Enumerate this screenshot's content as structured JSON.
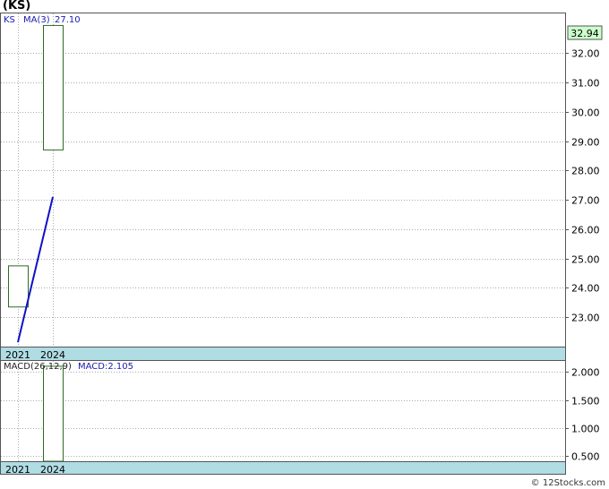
{
  "title": "(KS)",
  "credit": "© 12Stocks.com",
  "colors": {
    "candle_stroke": "#2e6b22",
    "ma_line": "#1010c8",
    "label_blue": "#1a1ab4",
    "axis_band": "#b0dce4",
    "last_price_bg": "#ccffcc",
    "grid": "#aaaaaa"
  },
  "chart_data": [
    {
      "type": "candlestick",
      "legend": {
        "symbol": "KS",
        "ma_label": "MA(3)",
        "ma_value": "27.10"
      },
      "categories": [
        "2021",
        "2024"
      ],
      "candles": [
        {
          "x": "2021",
          "open": 23.35,
          "close": 24.75,
          "high": 24.75,
          "low": 23.35
        },
        {
          "x": "2024",
          "open": 28.7,
          "close": 32.94,
          "high": 32.94,
          "low": 28.7
        }
      ],
      "ma_line": [
        {
          "x": "2021",
          "y": 22.15
        },
        {
          "x": "2024",
          "y": 27.1
        }
      ],
      "last_price": "32.94",
      "yticks": [
        "23.00",
        "24.00",
        "25.00",
        "26.00",
        "27.00",
        "28.00",
        "29.00",
        "30.00",
        "31.00",
        "32.00"
      ],
      "ytick_values": [
        23,
        24,
        25,
        26,
        27,
        28,
        29,
        30,
        31,
        32
      ],
      "ylim": [
        22,
        33.35
      ],
      "xlabels": [
        "2021",
        "2024"
      ],
      "grid": true
    },
    {
      "type": "bar",
      "legend": {
        "label": "MACD(26,12,9)",
        "value_label": "MACD:2.105"
      },
      "categories": [
        "2021",
        "2024"
      ],
      "values": [
        null,
        2.105
      ],
      "yticks": [
        "0.500",
        "1.000",
        "1.500",
        "2.000"
      ],
      "ytick_values": [
        0.5,
        1.0,
        1.5,
        2.0
      ],
      "ylim": [
        0.4,
        2.2
      ],
      "xlabels": [
        "2021",
        "2024"
      ],
      "grid": true
    }
  ]
}
